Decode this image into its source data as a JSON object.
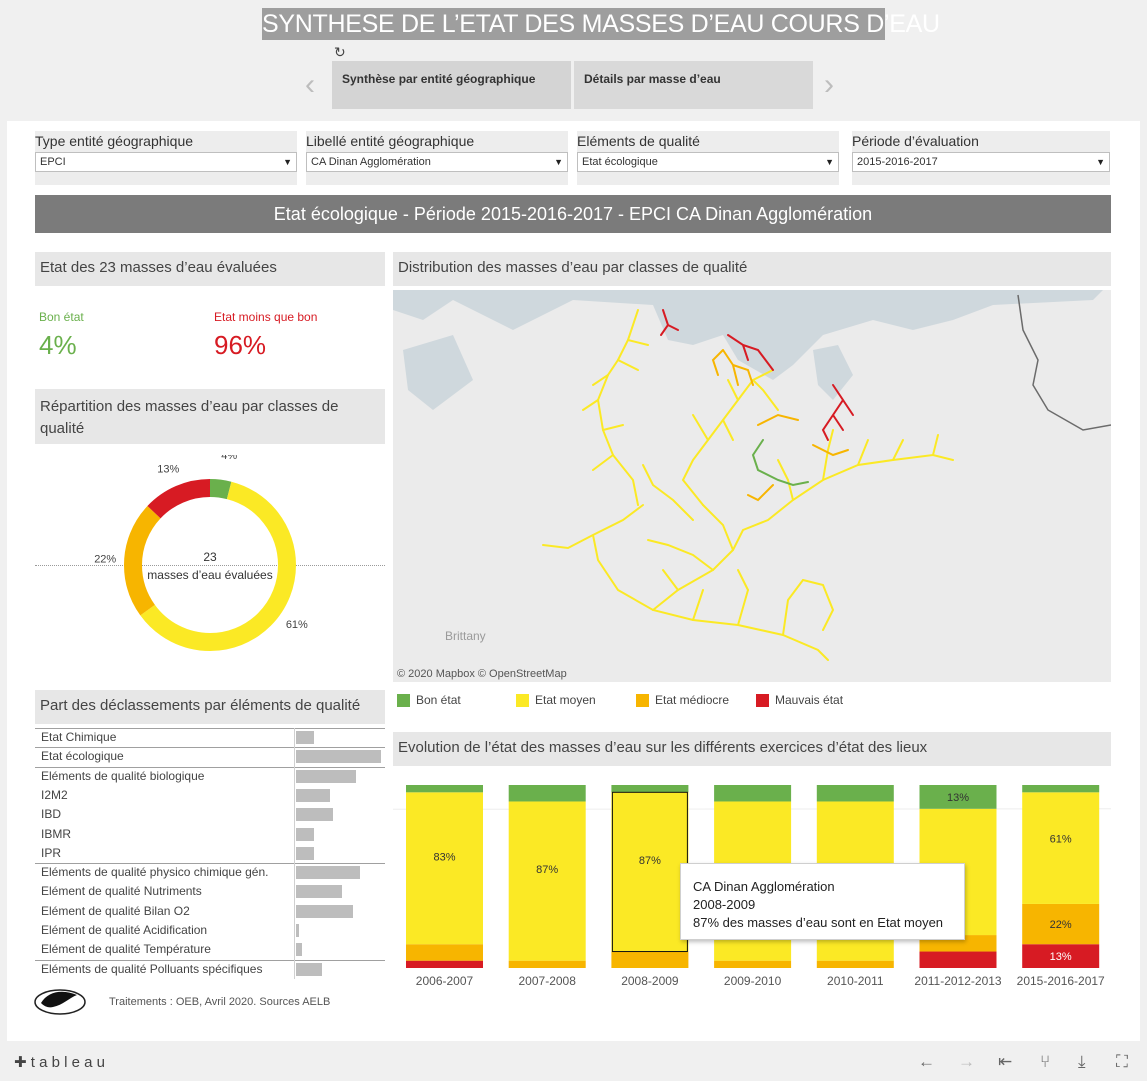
{
  "header": {
    "title": "SYNTHESE DE L’ETAT DES MASSES D’EAU COURS D’EAU",
    "tabs": [
      {
        "label": "Synthèse par entité géographique"
      },
      {
        "label": "Détails par masse d’eau"
      }
    ]
  },
  "filters": [
    {
      "label": "Type entité géographique",
      "value": "EPCI"
    },
    {
      "label": "Libellé entité géographique",
      "value": "CA Dinan Agglomération"
    },
    {
      "label": "Eléments de qualité",
      "value": "Etat écologique"
    },
    {
      "label": "Période d’évaluation",
      "value": "2015-2016-2017"
    }
  ],
  "dashboard_title": "Etat écologique  - Période 2015-2016-2017 - EPCI CA Dinan Agglomération",
  "state_summary": {
    "heading": "Etat des 23 masses d’eau évaluées",
    "good_label": "Bon état",
    "good_value": "4%",
    "bad_label": "Etat moins que bon",
    "bad_value": "96%"
  },
  "repartition": {
    "heading": "Répartition des masses d’eau par classes de qualité",
    "center_count": "23",
    "center_label": "masses d’eau évaluées"
  },
  "map": {
    "heading": "Distribution des masses d’eau par classes de qualité",
    "place_label": "Brittany",
    "attribution": "© 2020 Mapbox © OpenStreetMap"
  },
  "legend": [
    {
      "label": "Bon état",
      "color": "#6ab04c"
    },
    {
      "label": "Etat moyen",
      "color": "#fbe925"
    },
    {
      "label": "Etat médiocre",
      "color": "#f7b500"
    },
    {
      "label": "Mauvais état",
      "color": "#d71b23"
    }
  ],
  "declassements": {
    "heading": "Part des déclassements par éléments de qualité",
    "rows": [
      {
        "label": "Etat Chimique",
        "value": 0.21
      },
      {
        "label": "Etat écologique",
        "value": 1.0
      },
      {
        "label": "Eléments de qualité biologique",
        "value": 0.71
      },
      {
        "label": "I2M2",
        "value": 0.4
      },
      {
        "label": "IBD",
        "value": 0.44
      },
      {
        "label": "IBMR",
        "value": 0.21
      },
      {
        "label": "IPR",
        "value": 0.21
      },
      {
        "label": "Eléments de qualité physico chimique gén.",
        "value": 0.75
      },
      {
        "label": "Elément de qualité Nutriments",
        "value": 0.54
      },
      {
        "label": "Elément de qualité Bilan O2",
        "value": 0.67
      },
      {
        "label": "Elément de qualité Acidification",
        "value": 0.04
      },
      {
        "label": "Elément de qualité Température",
        "value": 0.07
      },
      {
        "label": "Eléments de qualité Polluants spécifiques",
        "value": 0.31
      }
    ]
  },
  "evolution": {
    "heading": "Evolution de l’état des masses d’eau sur les différents exercices d’état des lieux"
  },
  "tooltip": {
    "line1": "CA Dinan Agglomération",
    "line2": "2008-2009",
    "line3": "87%  des masses d’eau sont en Etat moyen"
  },
  "source_note": "Traitements : OEB, Avril 2020. Sources AELB",
  "footer": {
    "brand": "t a b l e a u"
  },
  "chart_data": [
    {
      "type": "pie",
      "title": "",
      "categories": [
        "Bon état",
        "Etat moyen",
        "Etat médiocre",
        "Mauvais état"
      ],
      "values": [
        4,
        61,
        22,
        13
      ],
      "labels": [
        "4%",
        "61%",
        "22%",
        "13%"
      ],
      "colors": [
        "#6ab04c",
        "#fbe925",
        "#f7b500",
        "#d71b23"
      ]
    },
    {
      "type": "bar",
      "stacked": true,
      "title": "",
      "categories": [
        "2006-2007",
        "2007-2008",
        "2008-2009",
        "2009-2010",
        "2010-2011",
        "2011-2012-2013",
        "2015-2016-2017"
      ],
      "series": [
        {
          "name": "Mauvais état",
          "color": "#d71b23",
          "values": [
            4,
            0,
            0,
            0,
            0,
            9,
            13
          ]
        },
        {
          "name": "Etat médiocre",
          "color": "#f7b500",
          "values": [
            9,
            4,
            9,
            4,
            4,
            9,
            22
          ]
        },
        {
          "name": "Etat moyen",
          "color": "#fbe925",
          "values": [
            83,
            87,
            87,
            87,
            87,
            69,
            61
          ]
        },
        {
          "name": "Bon état",
          "color": "#6ab04c",
          "values": [
            4,
            9,
            4,
            9,
            9,
            13,
            4
          ]
        }
      ],
      "data_labels": [
        {
          "category": "2006-2007",
          "series": "Etat moyen",
          "text": "83%"
        },
        {
          "category": "2007-2008",
          "series": "Etat moyen",
          "text": "87%"
        },
        {
          "category": "2008-2009",
          "series": "Etat moyen",
          "text": "87%"
        },
        {
          "category": "2011-2012-2013",
          "series": "Bon état",
          "text": "13%"
        },
        {
          "category": "2015-2016-2017",
          "series": "Etat moyen",
          "text": "61%"
        },
        {
          "category": "2015-2016-2017",
          "series": "Etat médiocre",
          "text": "22%"
        },
        {
          "category": "2015-2016-2017",
          "series": "Mauvais état",
          "text": "13%"
        }
      ],
      "highlighted_category": "2008-2009",
      "ylim": [
        0,
        100
      ]
    }
  ]
}
